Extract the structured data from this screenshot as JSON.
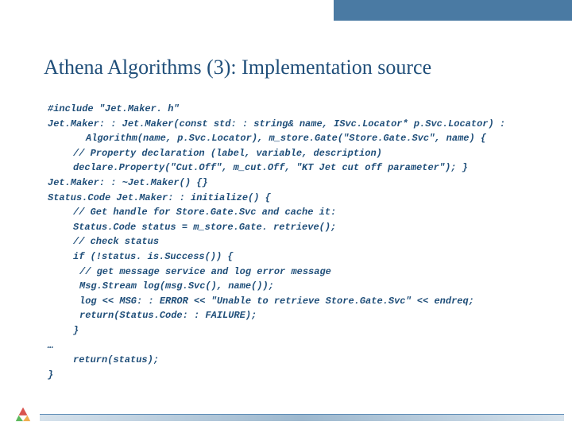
{
  "title": "Athena Algorithms (3): Implementation source",
  "code": {
    "l0": "#include \"Jet.Maker. h\"",
    "l1": "Jet.Maker: : Jet.Maker(const std: : string& name, ISvc.Locator* p.Svc.Locator) :",
    "l2": "Algorithm(name, p.Svc.Locator), m_store.Gate(\"Store.Gate.Svc\", name) {",
    "l3": "// Property declaration (label, variable, description)",
    "l4": "declare.Property(\"Cut.Off\", m_cut.Off, \"KT Jet cut off parameter\"); }",
    "l5": "Jet.Maker: : ~Jet.Maker() {}",
    "l6": "Status.Code Jet.Maker: : initialize() {",
    "l7": "// Get handle for Store.Gate.Svc and cache it:",
    "l8": "Status.Code status = m_store.Gate. retrieve();",
    "l9": "// check status",
    "l10": "if (!status. is.Success()) {",
    "l11": "// get message service and log error message",
    "l12": "Msg.Stream log(msg.Svc(), name());",
    "l13": "log << MSG: : ERROR << \"Unable to retrieve Store.Gate.Svc\" << endreq;",
    "l14": "return(Status.Code: : FAILURE);",
    "l15": "}",
    "l16": "…",
    "l17": "return(status);",
    "l18": "}"
  }
}
